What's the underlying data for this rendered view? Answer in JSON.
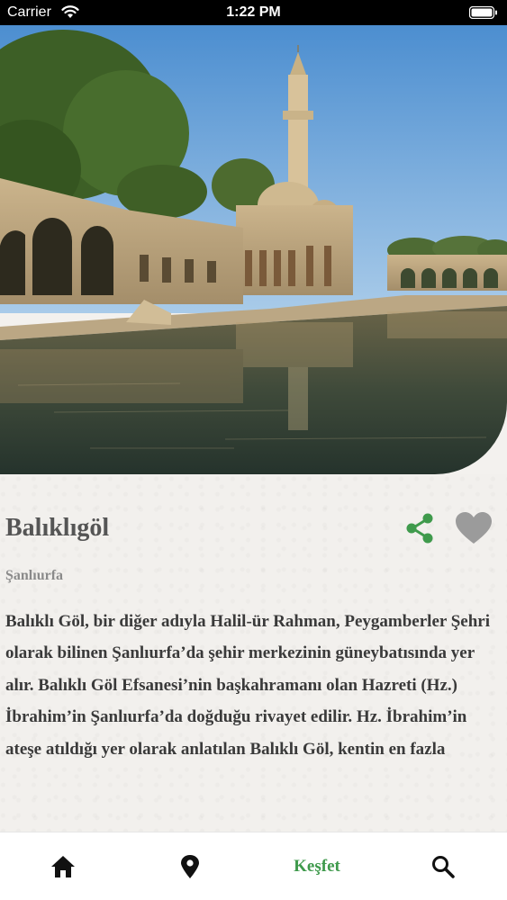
{
  "status_bar": {
    "carrier": "Carrier",
    "time": "1:22 PM",
    "wifi_icon": "wifi-icon",
    "battery_icon": "battery-icon"
  },
  "hero": {
    "image_subject": "Balıklıgöl pool with mosque and minaret"
  },
  "place": {
    "title": "Balıklıgöl",
    "city": "Şanlıurfa",
    "description": "Balıklı Göl, bir diğer adıyla Halil-ür Rahman, Peygamberler Şehri olarak bilinen Şanlıurfa’da şehir merkezinin güneybatısında yer alır. Balıklı Göl Efsanesi’nin başkahramanı olan Hazreti (Hz.) İbrahim’in Şanlıurfa’da doğduğu rivayet edilir. Hz. İbrahim’in ateşe atıldığı yer olarak anlatılan Balıklı Göl, kentin en fazla"
  },
  "actions": {
    "share_icon": "share-icon",
    "favorite_icon": "heart-icon",
    "share_color": "#3f9a4c",
    "favorite_color": "#9b9b9b"
  },
  "bottom_nav": {
    "items": [
      {
        "icon": "home-icon",
        "active": false
      },
      {
        "icon": "map-pin-icon",
        "active": false
      },
      {
        "label": "Keşfet",
        "active": true
      },
      {
        "icon": "search-icon",
        "active": false
      }
    ],
    "active_color": "#3f9a4c"
  }
}
